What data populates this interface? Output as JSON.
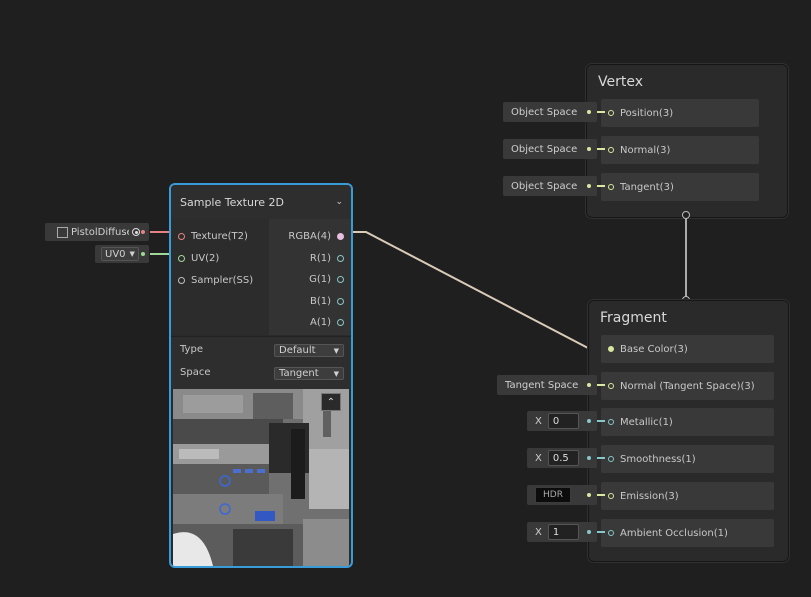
{
  "vertex": {
    "title": "Vertex",
    "slots": [
      {
        "label": "Position(3)",
        "space": "Object Space"
      },
      {
        "label": "Normal(3)",
        "space": "Object Space"
      },
      {
        "label": "Tangent(3)",
        "space": "Object Space"
      }
    ]
  },
  "fragment": {
    "title": "Fragment",
    "slots": [
      {
        "label": "Base Color(3)"
      },
      {
        "label": "Normal (Tangent Space)(3)",
        "space": "Tangent Space"
      },
      {
        "label": "Metallic(1)",
        "x_label": "X",
        "value": "0"
      },
      {
        "label": "Smoothness(1)",
        "x_label": "X",
        "value": "0.5"
      },
      {
        "label": "Emission(3)",
        "hdr": "HDR"
      },
      {
        "label": "Ambient Occlusion(1)",
        "x_label": "X",
        "value": "1"
      }
    ]
  },
  "sample_node": {
    "title": "Sample Texture 2D",
    "inputs": [
      "Texture(T2)",
      "UV(2)",
      "Sampler(SS)"
    ],
    "outputs": [
      "RGBA(4)",
      "R(1)",
      "G(1)",
      "B(1)",
      "A(1)"
    ],
    "type_label": "Type",
    "type_value": "Default",
    "space_label": "Space",
    "space_value": "Tangent"
  },
  "texture_input": {
    "name": "PistolDiffuse"
  },
  "uv_input": {
    "value": "UV0"
  },
  "colors": {
    "selection": "#3a9bd9",
    "vector3": "#d8e8a0",
    "float": "#87c7c9",
    "texture": "#e38282",
    "uv": "#9fd79a",
    "rgba": "#e7bfe0"
  }
}
